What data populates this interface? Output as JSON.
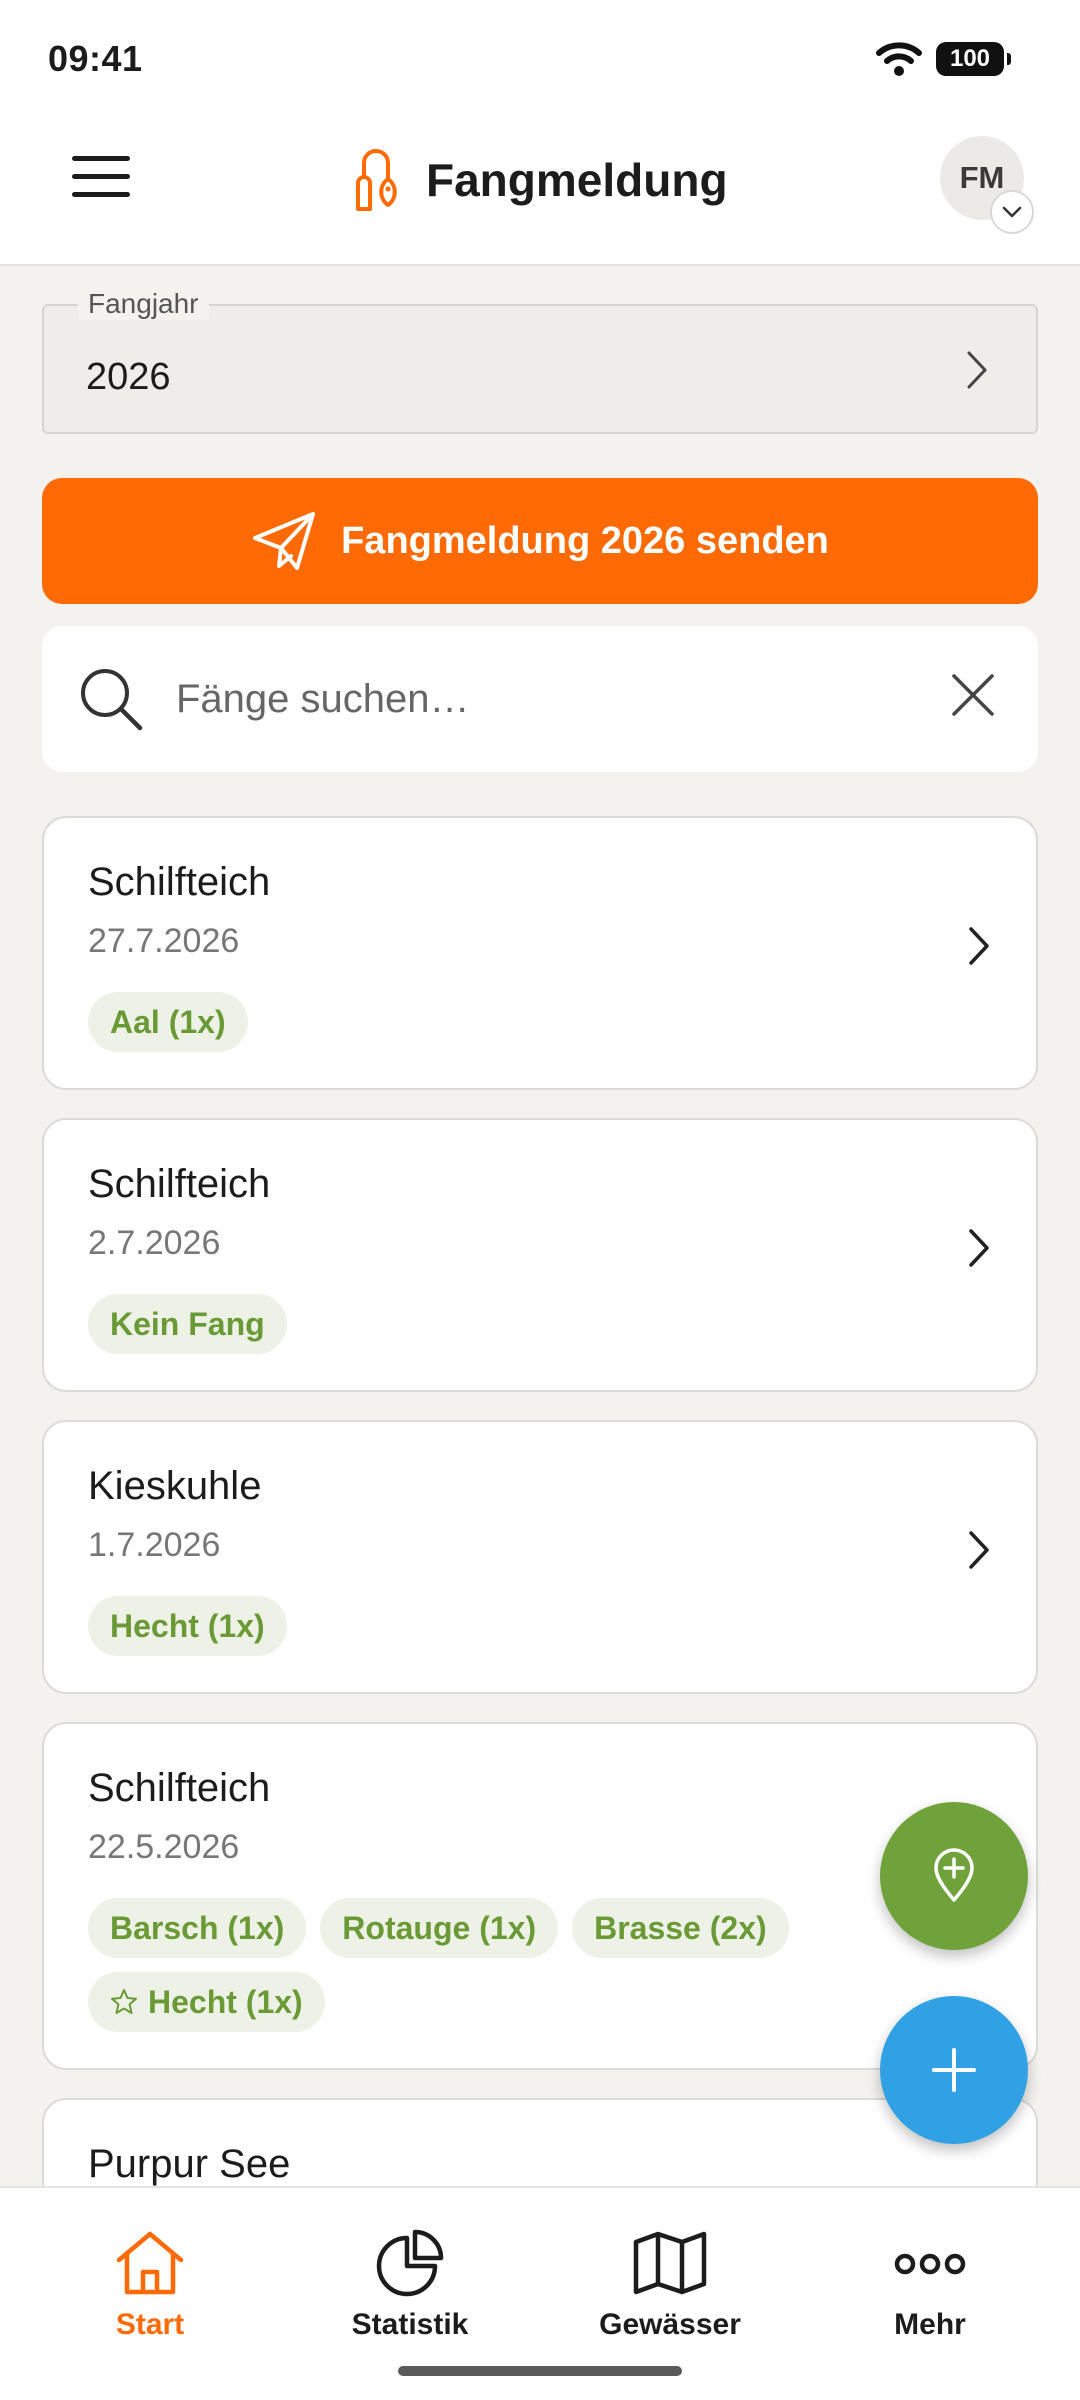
{
  "status_bar": {
    "time": "09:41",
    "battery": "100"
  },
  "header": {
    "title": "Fangmeldung",
    "avatar_initials": "FM"
  },
  "year_field": {
    "label": "Fangjahr",
    "value": "2026"
  },
  "send_button": {
    "label": "Fangmeldung 2026 senden"
  },
  "search": {
    "placeholder": "Fänge suchen…",
    "value": ""
  },
  "catches": [
    {
      "water": "Schilfteich",
      "date": "27.7.2026",
      "tags": [
        {
          "label": "Aal (1x)"
        }
      ]
    },
    {
      "water": "Schilfteich",
      "date": "2.7.2026",
      "tags": [
        {
          "label": "Kein Fang"
        }
      ]
    },
    {
      "water": "Kieskuhle",
      "date": "1.7.2026",
      "tags": [
        {
          "label": "Hecht (1x)"
        }
      ]
    },
    {
      "water": "Schilfteich",
      "date": "22.5.2026",
      "tags": [
        {
          "label": "Barsch (1x)"
        },
        {
          "label": "Rotauge (1x)"
        },
        {
          "label": "Brasse (2x)"
        },
        {
          "label": "Hecht (1x)",
          "starred": true
        }
      ]
    },
    {
      "water": "Purpur See"
    }
  ],
  "bottom_nav": [
    {
      "label": "Start",
      "icon": "home-icon",
      "active": true
    },
    {
      "label": "Statistik",
      "icon": "pie-chart-icon"
    },
    {
      "label": "Gewässer",
      "icon": "map-icon"
    },
    {
      "label": "Mehr",
      "icon": "more-icon"
    }
  ],
  "colors": {
    "accent": "#ff6a04",
    "green": "#6fa23a",
    "blue": "#31a1e6",
    "tag_text": "#6a9a35",
    "tag_bg": "#eef1e6"
  }
}
